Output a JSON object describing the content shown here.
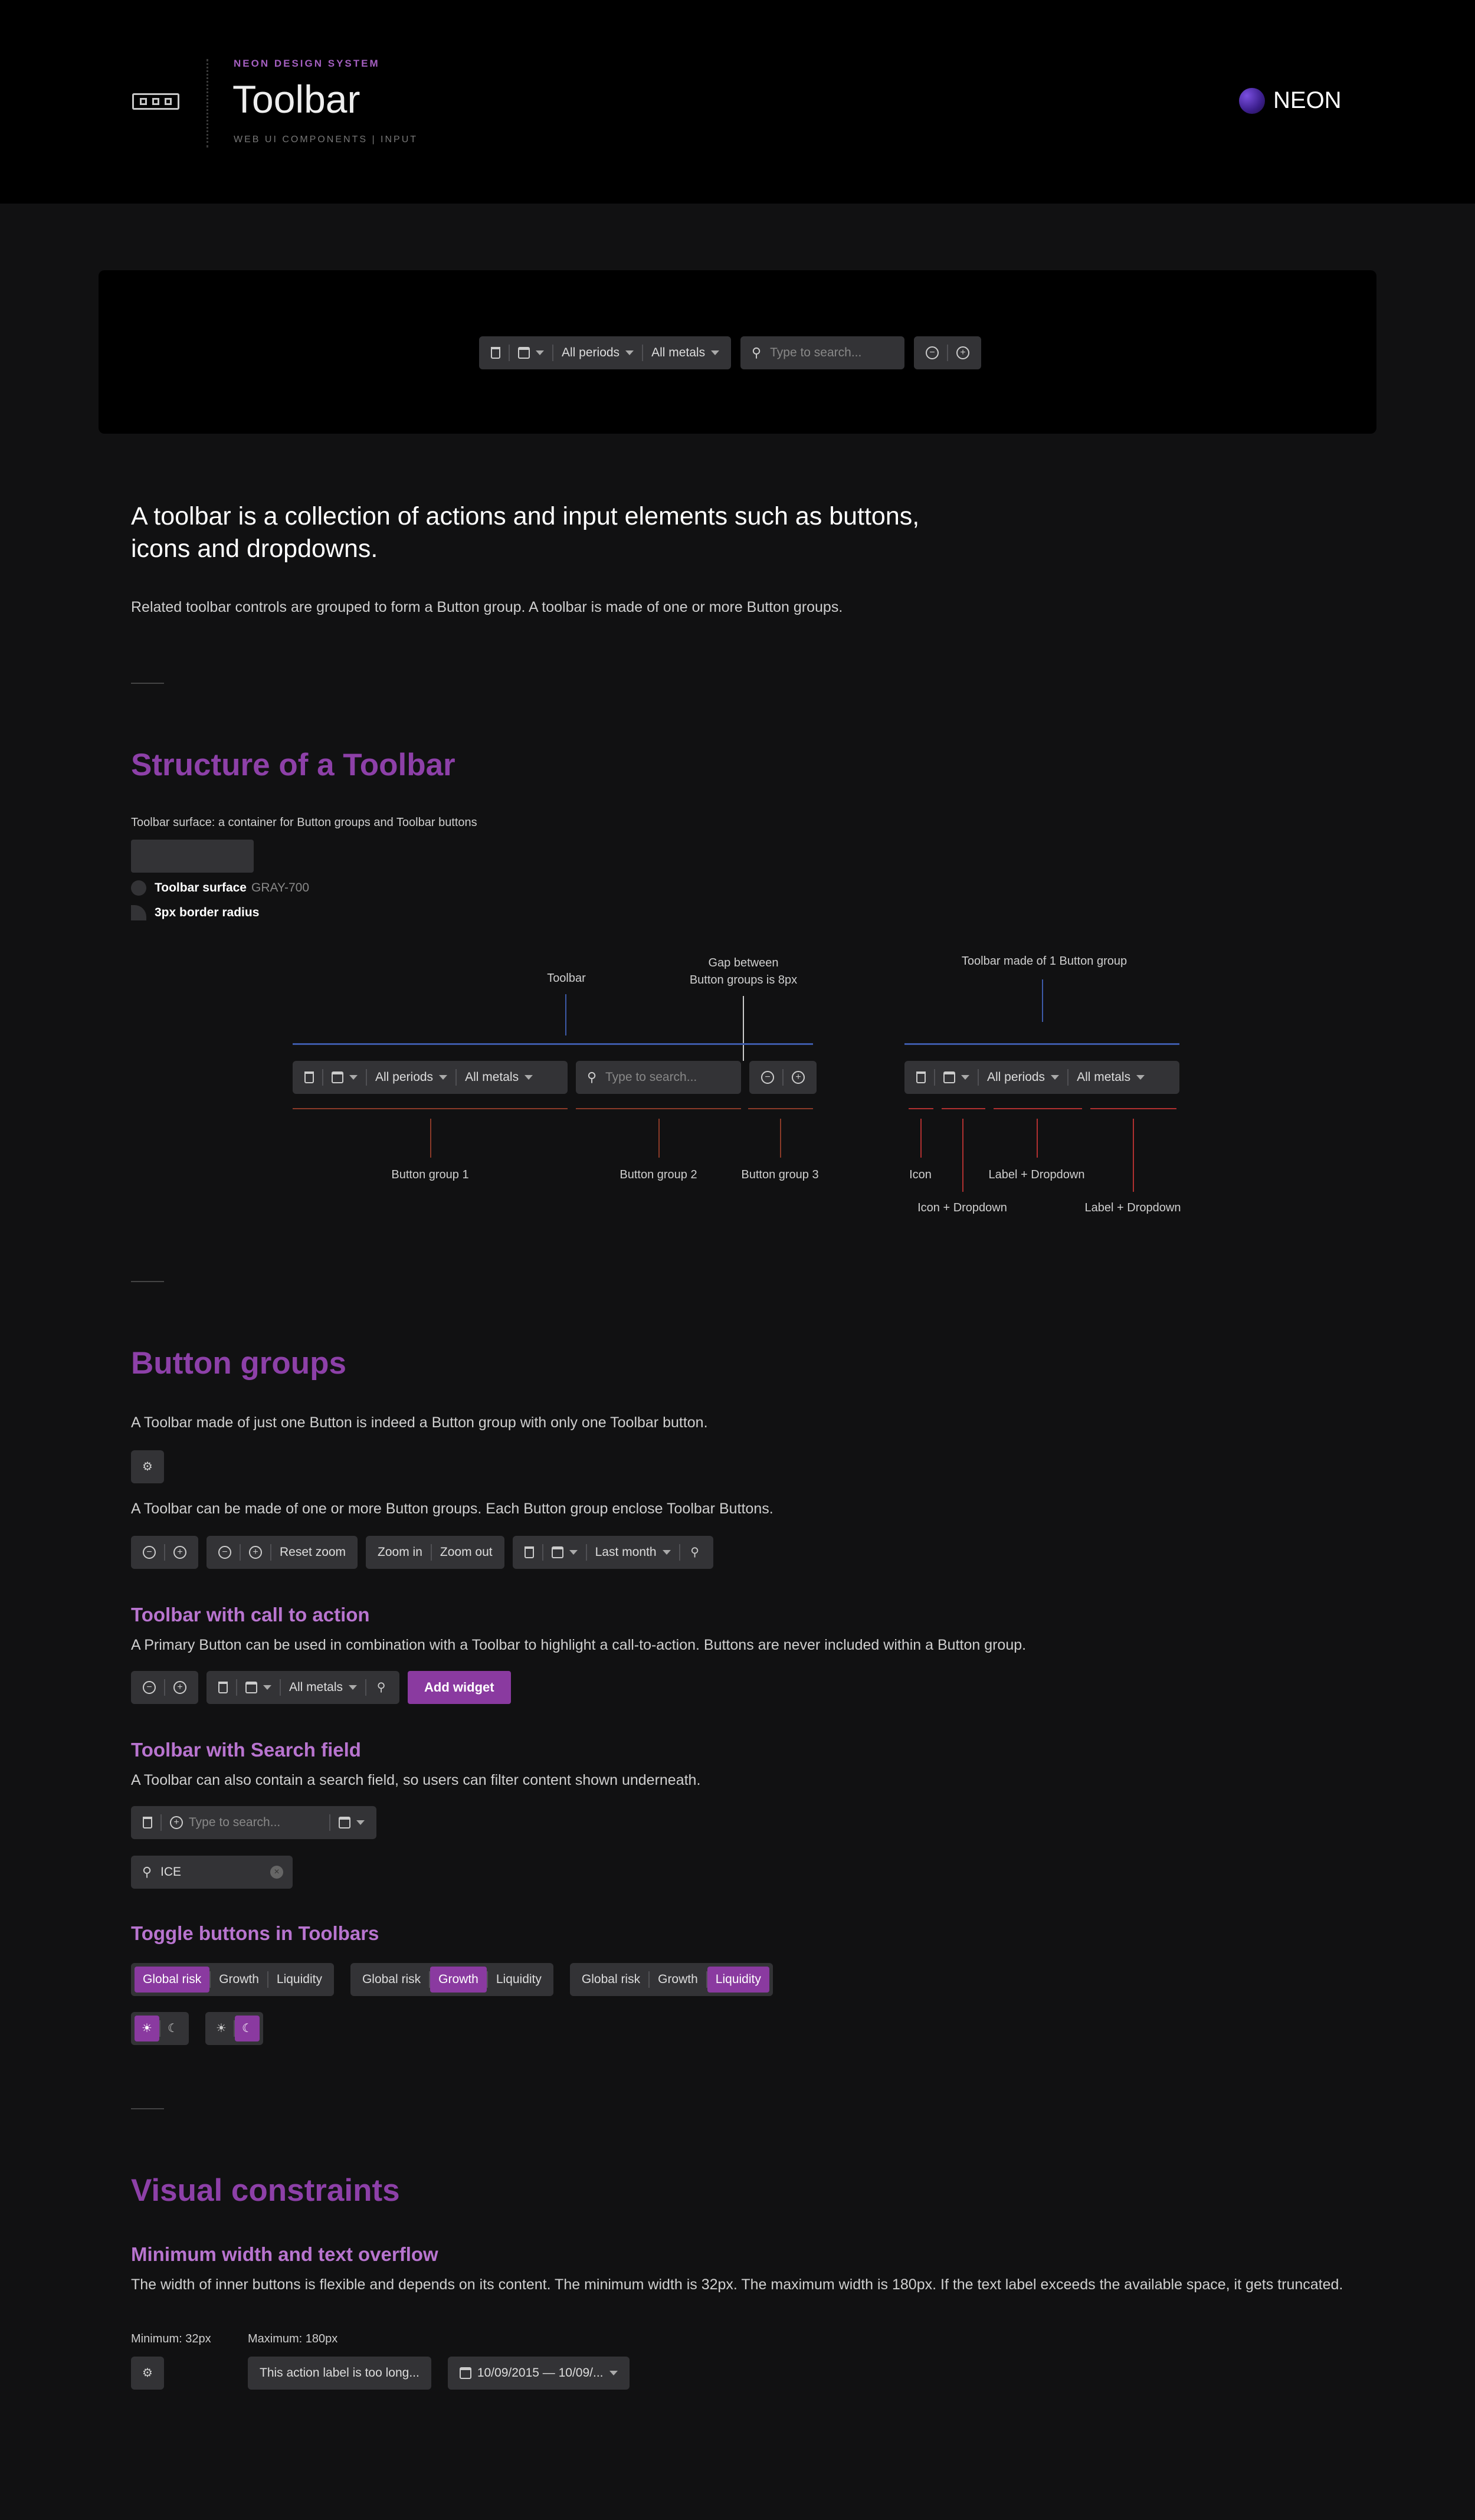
{
  "header": {
    "eyebrow": "NEON DESIGN SYSTEM",
    "title": "Toolbar",
    "subtitle": "WEB UI COMPONENTS | INPUT",
    "brand": "NEON"
  },
  "toolbar": {
    "all_periods": "All periods",
    "all_metals": "All metals",
    "search_placeholder": "Type to search...",
    "last_month": "Last month",
    "reset_zoom": "Reset zoom",
    "zoom_in": "Zoom in",
    "zoom_out": "Zoom out",
    "add_widget": "Add widget",
    "search_value": "ICE"
  },
  "intro": {
    "lead": "A toolbar is a collection of actions and input elements such as buttons, icons and dropdowns.",
    "body": "Related toolbar controls are grouped to form a Button group. A toolbar is made of one or more Button groups."
  },
  "structure": {
    "heading": "Structure of a Toolbar",
    "surface_caption": "Toolbar surface: a container for Button groups and Toolbar buttons",
    "surface_label": "Toolbar surface",
    "surface_token": "GRAY-700",
    "radius_label": "3px border radius",
    "ann_toolbar": "Toolbar",
    "ann_gap_1": "Gap between",
    "ann_gap_2": "Button groups is 8px",
    "ann_one_group": "Toolbar made of 1 Button group",
    "ann_group1": "Button group 1",
    "ann_group2": "Button group 2",
    "ann_group3": "Button group 3",
    "ann_icon": "Icon",
    "ann_icon_dropdown": "Icon + Dropdown",
    "ann_label_dropdown_1": "Label + Dropdown",
    "ann_label_dropdown_2": "Label + Dropdown"
  },
  "groups": {
    "heading": "Button groups",
    "p1": "A Toolbar made of just one Button is indeed a Button group with only one Toolbar button.",
    "p2": "A Toolbar can be made of one or more Button groups. Each Button group enclose Toolbar Buttons.",
    "cta_heading": "Toolbar with call to action",
    "cta_p": "A Primary Button can be used in combination with a Toolbar to highlight a call-to-action. Buttons are never included within a Button group.",
    "search_heading": "Toolbar with Search field",
    "search_p": "A Toolbar can also contain a search field, so users can filter content shown underneath.",
    "toggle_heading": "Toggle buttons in Toolbars",
    "toggle_labels": [
      "Global risk",
      "Growth",
      "Liquidity"
    ]
  },
  "constraints": {
    "heading": "Visual constraints",
    "sub_heading": "Minimum width and text overflow",
    "p": "The width of inner buttons is flexible and depends on its content. The minimum width is 32px. The maximum width is 180px. If the text label exceeds the available space, it gets truncated.",
    "min_label": "Minimum: 32px",
    "max_label": "Maximum: 180px",
    "long_label": "This action label is too long...",
    "date_label": "10/09/2015 — 10/09/..."
  },
  "colors": {
    "accent": "#8d40a8",
    "surface": "#333336",
    "annotation_blue": "#3d5aa8",
    "annotation_red": "#8a3a28"
  }
}
